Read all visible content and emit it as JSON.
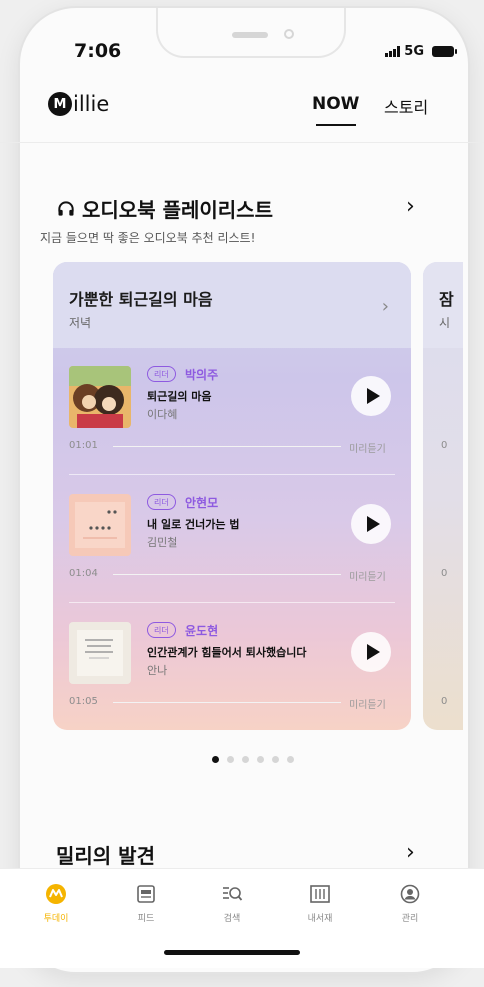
{
  "status": {
    "time": "7:06",
    "network": "5G"
  },
  "header": {
    "logo_letter": "M",
    "logo_text": "illie",
    "tab_now": "NOW",
    "tab_story": "스토리"
  },
  "audiobook_section": {
    "title": "오디오북 플레이리스트",
    "subtitle": "지금 들으면 딱 좋은 오디오북 추천 리스트!",
    "icon": "headphones-icon",
    "arrow": "›"
  },
  "playlist_card": {
    "title": "가뿐한 퇴근길의 마음",
    "subtitle": "저녁",
    "tracks": [
      {
        "badge": "리더",
        "reader": "박의주",
        "title": "퇴근길의 마음",
        "author": "이다혜",
        "time": "01:01",
        "preview": "미리듣기"
      },
      {
        "badge": "리더",
        "reader": "안현모",
        "title": "내 일로 건너가는 법",
        "author": "김민철",
        "time": "01:04",
        "preview": "미리듣기"
      },
      {
        "badge": "리더",
        "reader": "윤도현",
        "title": "인간관계가 힘들어서 퇴사했습니다",
        "author": "안나",
        "time": "01:05",
        "preview": "미리듣기"
      }
    ]
  },
  "next_card": {
    "title_char": "잠",
    "subtitle_char": "시",
    "time_char": "0"
  },
  "carousel": {
    "count": 6,
    "active": 0
  },
  "discover_section": {
    "title": "밀리의 발견",
    "arrow": "›"
  },
  "tabbar": {
    "items": [
      {
        "label": "투데이",
        "icon": "today-icon",
        "active": true
      },
      {
        "label": "피드",
        "icon": "feed-icon",
        "active": false
      },
      {
        "label": "검색",
        "icon": "search-icon",
        "active": false
      },
      {
        "label": "내서재",
        "icon": "library-icon",
        "active": false
      },
      {
        "label": "관리",
        "icon": "profile-icon",
        "active": false
      }
    ]
  },
  "colors": {
    "accent": "#f5b400",
    "reader": "#8e5ae0"
  }
}
